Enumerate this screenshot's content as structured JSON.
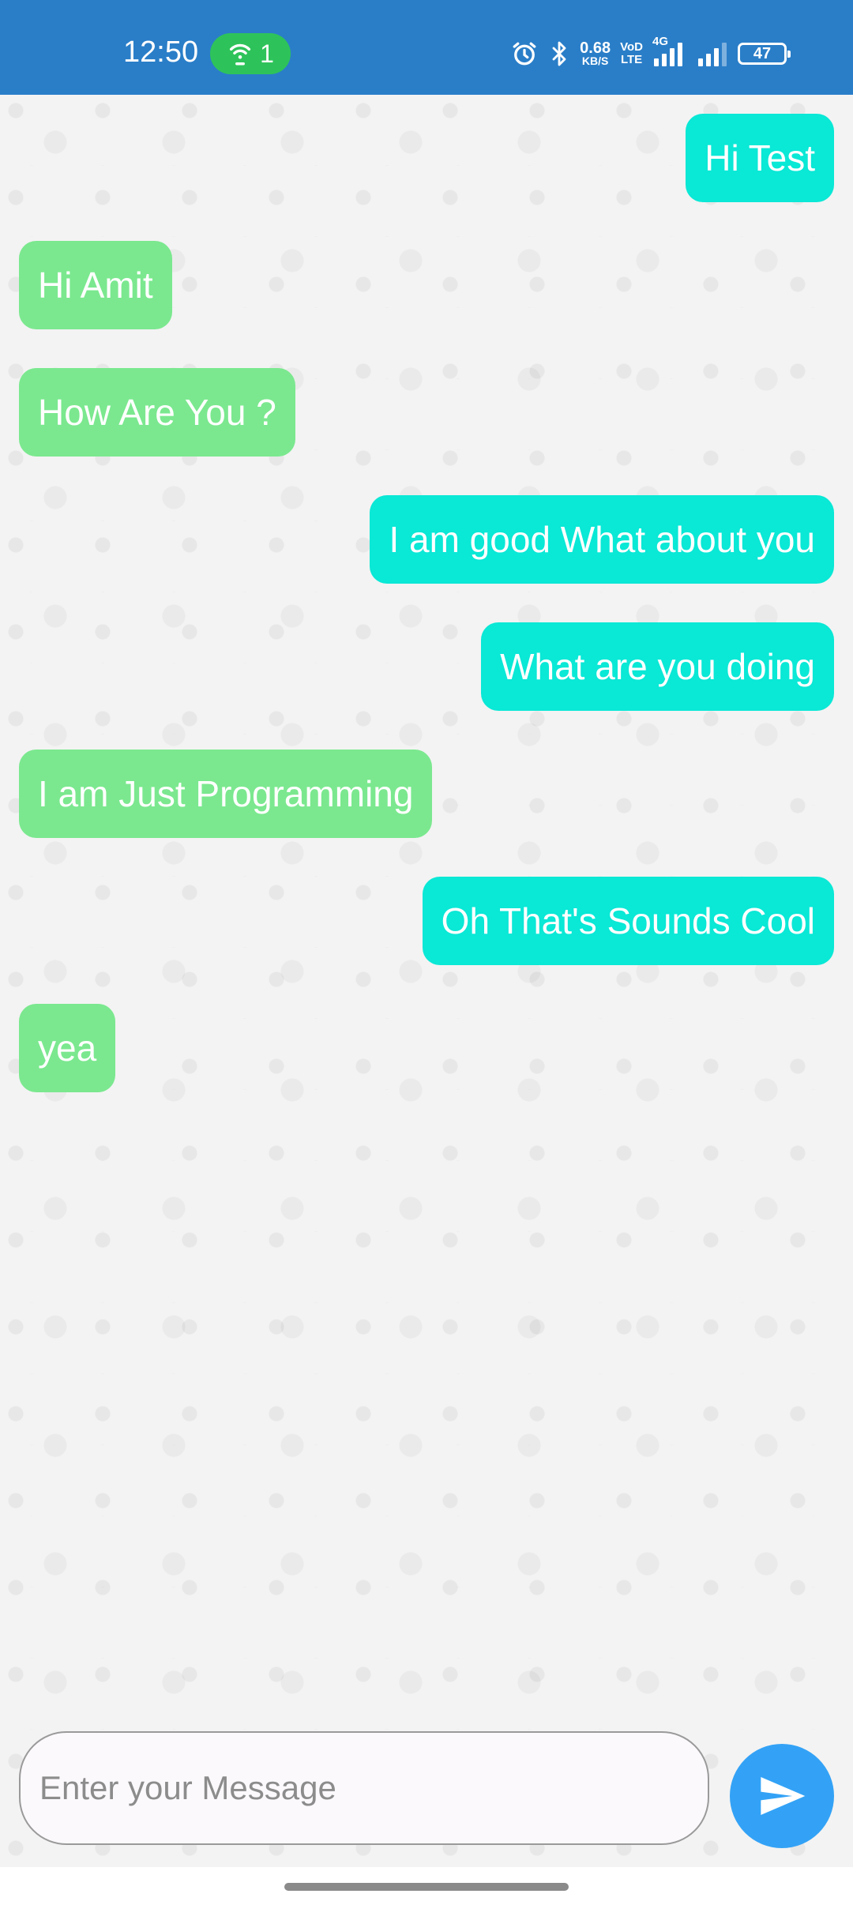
{
  "status_bar": {
    "time": "12:50",
    "hotspot_count": "1",
    "network_speed": "0.68",
    "network_speed_unit": "KB/S",
    "volte_top": "VoD",
    "volte_bottom": "LTE",
    "network_type": "4G",
    "battery": "47",
    "icons": [
      "hotspot-icon",
      "alarm-icon",
      "bluetooth-icon",
      "signal-icon",
      "signal-icon",
      "battery-icon"
    ],
    "colors": {
      "background": "#2a7ec8",
      "hotspot_pill": "#2ec35a"
    }
  },
  "messages": [
    {
      "text": "Hi Test",
      "type": "sent"
    },
    {
      "text": "Hi Amit",
      "type": "received"
    },
    {
      "text": "How Are You ?",
      "type": "received"
    },
    {
      "text": "I am good What about you",
      "type": "sent"
    },
    {
      "text": "What are you doing",
      "type": "sent"
    },
    {
      "text": "I am Just Programming",
      "type": "received"
    },
    {
      "text": "Oh That's Sounds Cool",
      "type": "sent"
    },
    {
      "text": "yea",
      "type": "received"
    }
  ],
  "composer": {
    "placeholder": "Enter your Message",
    "value": "",
    "send_icon": "send-icon"
  },
  "colors": {
    "sent_bubble": "#0ae8d6",
    "received_bubble": "#7be88f",
    "send_button": "#33a2f6"
  }
}
